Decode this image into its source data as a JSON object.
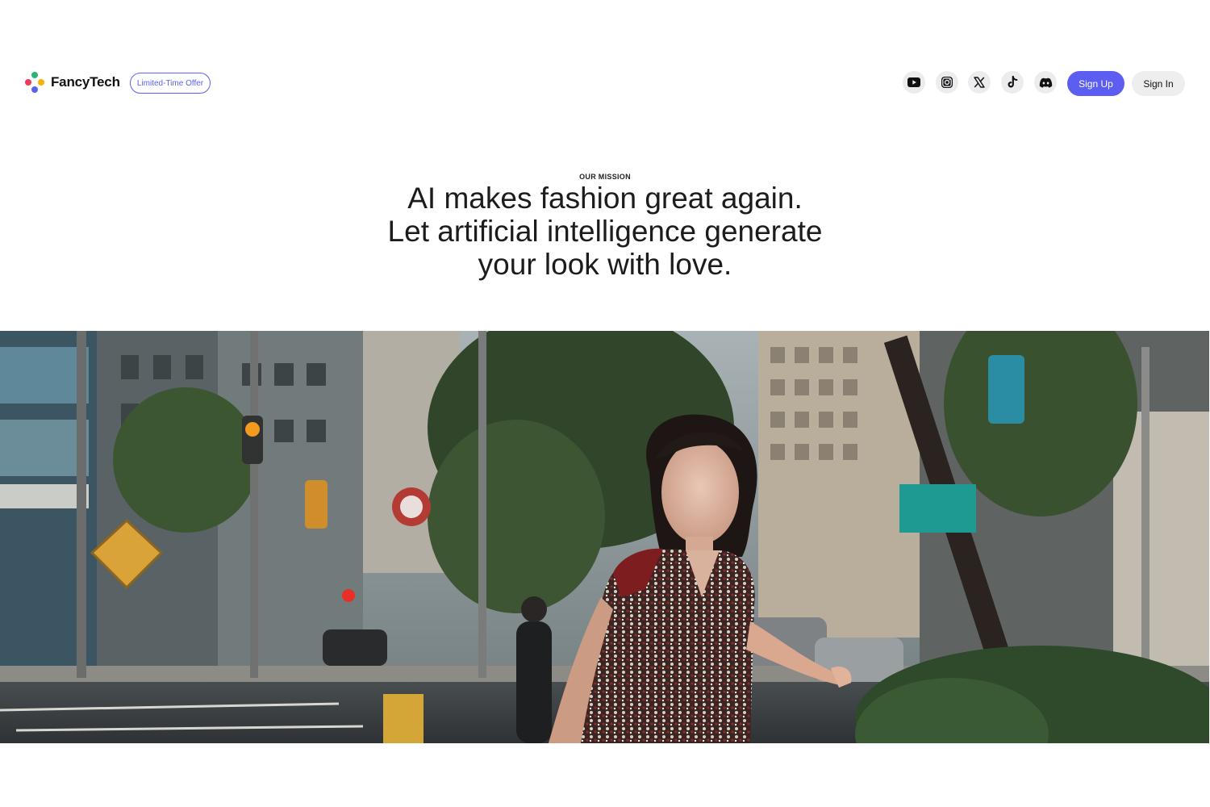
{
  "header": {
    "brand": "FancyTech",
    "offer_badge": "Limited-Time Offer",
    "social_icons": [
      "youtube-icon",
      "instagram-icon",
      "x-icon",
      "tiktok-icon",
      "discord-icon"
    ],
    "sign_up_label": "Sign Up",
    "sign_in_label": "Sign In"
  },
  "mission": {
    "eyebrow": "OUR MISSION",
    "headline_lines": [
      "AI makes fashion great again.",
      "Let artificial intelligence generate",
      "your look with love."
    ]
  },
  "hero": {
    "image_subject": "woman-in-sequin-dress-on-city-street"
  },
  "colors": {
    "accent": "#5b5ef0",
    "badge_border": "#5b62f0",
    "social_bg": "#ececee",
    "sign_in_bg": "#eeeeef",
    "text": "#1c1c1c",
    "logo_dots": [
      "#2bb673",
      "#ef3b5a",
      "#f4b400",
      "#5b62f0"
    ]
  }
}
